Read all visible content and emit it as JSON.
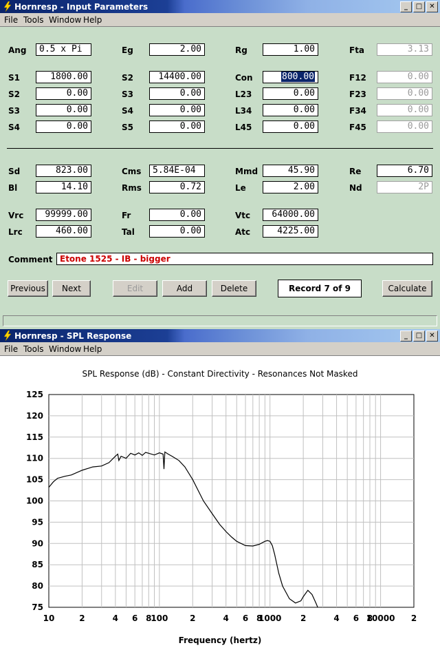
{
  "input_window": {
    "title": "Hornresp - Input Parameters",
    "menu": [
      "File",
      "Tools",
      "Window",
      "Help"
    ],
    "params": {
      "Ang": "0.5 x Pi",
      "Eg": "2.00",
      "Rg": "1.00",
      "Fta": "3.13",
      "S1": "1800.00",
      "S2a": "14400.00",
      "Con": "800.00",
      "F12": "0.00",
      "S2": "0.00",
      "S3a": "0.00",
      "L23": "0.00",
      "F23": "0.00",
      "S3": "0.00",
      "S4a": "0.00",
      "L34": "0.00",
      "F34": "0.00",
      "S4": "0.00",
      "S5": "0.00",
      "L45": "0.00",
      "F45": "0.00",
      "Sd": "823.00",
      "Cms": "5.84E-04",
      "Mmd": "45.90",
      "Re": "6.70",
      "Bl": "14.10",
      "Rms": "0.72",
      "Le": "2.00",
      "Nd": "2P",
      "Vrc": "99999.00",
      "Fr": "0.00",
      "Vtc": "64000.00",
      "Lrc": "460.00",
      "Tal": "0.00",
      "Atc": "4225.00"
    },
    "labels": {
      "Ang": "Ang",
      "Eg": "Eg",
      "Rg": "Rg",
      "Fta": "Fta",
      "S1": "S1",
      "S2a": "S2",
      "Con": "Con",
      "F12": "F12",
      "S2": "S2",
      "S3a": "S3",
      "L23": "L23",
      "F23": "F23",
      "S3": "S3",
      "S4a": "S4",
      "L34": "L34",
      "F34": "F34",
      "S4": "S4",
      "S5": "S5",
      "L45": "L45",
      "F45": "F45",
      "Sd": "Sd",
      "Cms": "Cms",
      "Mmd": "Mmd",
      "Re": "Re",
      "Bl": "Bl",
      "Rms": "Rms",
      "Le": "Le",
      "Nd": "Nd",
      "Vrc": "Vrc",
      "Fr": "Fr",
      "Vtc": "Vtc",
      "Lrc": "Lrc",
      "Tal": "Tal",
      "Atc": "Atc"
    },
    "comment_label": "Comment",
    "comment": "Etone 1525 - IB - bigger",
    "comment_color": "#cc0000",
    "buttons": {
      "previous": "Previous",
      "next": "Next",
      "edit": "Edit",
      "add": "Add",
      "delete": "Delete",
      "calculate": "Calculate"
    },
    "record": "Record 7 of 9"
  },
  "spl_window": {
    "title": "Hornresp - SPL Response",
    "menu": [
      "File",
      "Tools",
      "Window",
      "Help"
    ]
  },
  "chart_data": {
    "type": "line",
    "title": "SPL Response (dB) - Constant Directivity - Resonances Not Masked",
    "xlabel": "Frequency (hertz)",
    "ylabel": "",
    "xscale": "log",
    "xlim": [
      10,
      20000
    ],
    "ylim": [
      75,
      125
    ],
    "yticks": [
      75,
      80,
      85,
      90,
      95,
      100,
      105,
      110,
      115,
      120,
      125
    ],
    "xtick_labels": [
      {
        "x": 10,
        "label": "10"
      },
      {
        "x": 20,
        "label": "2"
      },
      {
        "x": 40,
        "label": "4"
      },
      {
        "x": 60,
        "label": "6"
      },
      {
        "x": 80,
        "label": "8"
      },
      {
        "x": 100,
        "label": "100"
      },
      {
        "x": 200,
        "label": "2"
      },
      {
        "x": 400,
        "label": "4"
      },
      {
        "x": 600,
        "label": "6"
      },
      {
        "x": 800,
        "label": "8"
      },
      {
        "x": 1000,
        "label": "1000"
      },
      {
        "x": 2000,
        "label": "2"
      },
      {
        "x": 4000,
        "label": "4"
      },
      {
        "x": 6000,
        "label": "6"
      },
      {
        "x": 8000,
        "label": "8"
      },
      {
        "x": 10000,
        "label": "10000"
      },
      {
        "x": 20000,
        "label": "2"
      }
    ],
    "grid": true,
    "series": [
      {
        "x": [
          10,
          11,
          12,
          14,
          16,
          20,
          25,
          30,
          35,
          40,
          42,
          43,
          45,
          50,
          55,
          60,
          65,
          70,
          75,
          80,
          90,
          100,
          108,
          110,
          112,
          120,
          130,
          150,
          170,
          200,
          250,
          300,
          350,
          400,
          450,
          500,
          600,
          700,
          800,
          900,
          950,
          1000,
          1050,
          1100,
          1200,
          1300,
          1500,
          1700,
          1900,
          2000,
          2200,
          2400,
          2500,
          2600,
          2700
        ],
        "y": [
          103.2,
          104.5,
          105.3,
          105.8,
          106.1,
          107.2,
          108.0,
          108.2,
          109.0,
          110.5,
          111.0,
          109.5,
          110.5,
          110.0,
          111.2,
          110.8,
          111.3,
          110.7,
          111.4,
          111.2,
          110.8,
          111.3,
          111.0,
          107.5,
          111.5,
          111.0,
          110.5,
          109.5,
          108.0,
          105.0,
          100.0,
          97.0,
          94.5,
          92.8,
          91.5,
          90.5,
          89.5,
          89.4,
          89.8,
          90.5,
          90.7,
          90.5,
          89.5,
          87.5,
          83.0,
          80.0,
          77.0,
          76.0,
          76.5,
          77.5,
          79.0,
          78.0,
          77.0,
          76.0,
          75.0
        ]
      }
    ]
  }
}
